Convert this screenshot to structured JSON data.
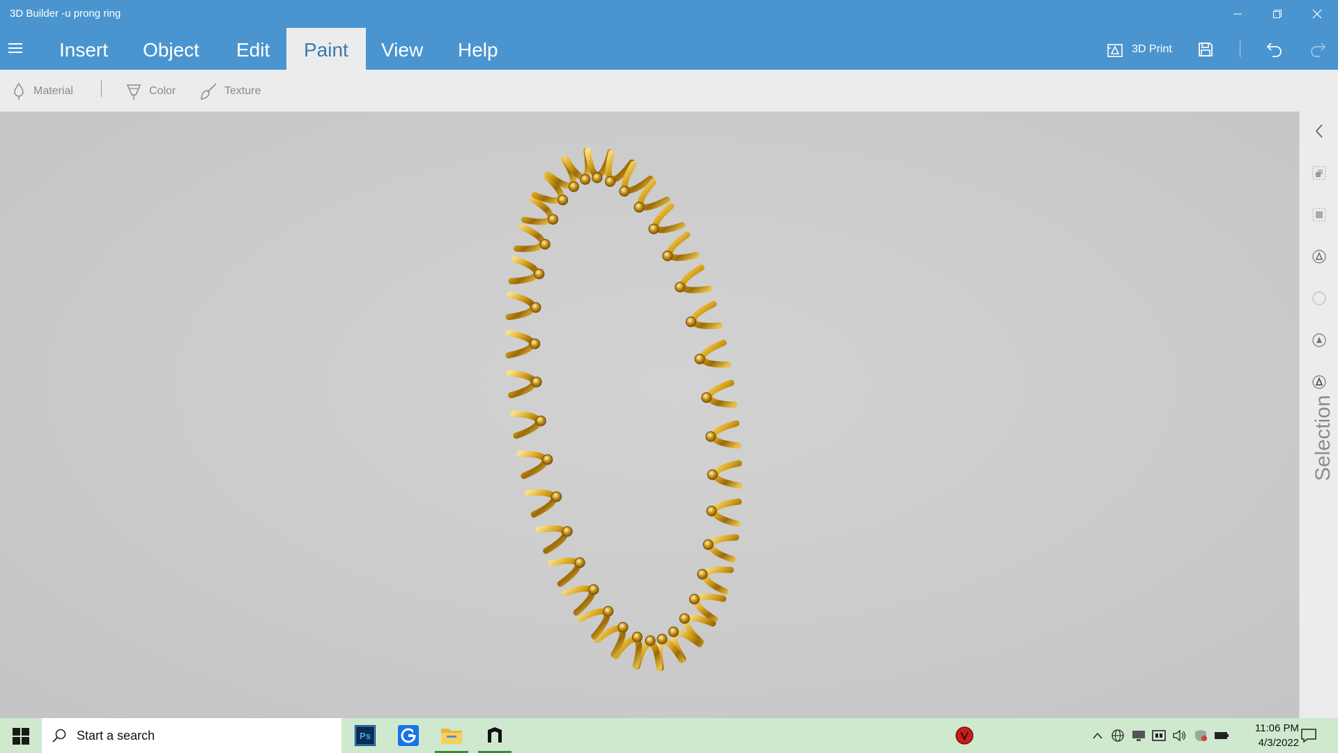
{
  "window": {
    "title": "3D Builder -u prong ring",
    "minimize_icon": "minimize-icon",
    "restore_icon": "restore-icon",
    "close_icon": "close-icon"
  },
  "ribbon": {
    "tabs": [
      {
        "label": "Insert"
      },
      {
        "label": "Object"
      },
      {
        "label": "Edit"
      },
      {
        "label": "Paint",
        "active": true
      },
      {
        "label": "View"
      },
      {
        "label": "Help"
      }
    ],
    "print_label": "3D Print",
    "accent_color": "#4a95d0"
  },
  "paint_toolbar": {
    "material_label": "Material",
    "color_label": "Color",
    "texture_label": "Texture"
  },
  "side_panel": {
    "label": "Selection"
  },
  "taskbar": {
    "search_placeholder": "Start a search",
    "apps": [
      "photoshop",
      "google-chrome",
      "file-explorer",
      "3d-builder"
    ],
    "clock_time": "11:06 PM",
    "clock_date": "4/3/2022",
    "photoshop_label": "Ps",
    "background": "#cfe9cf"
  }
}
